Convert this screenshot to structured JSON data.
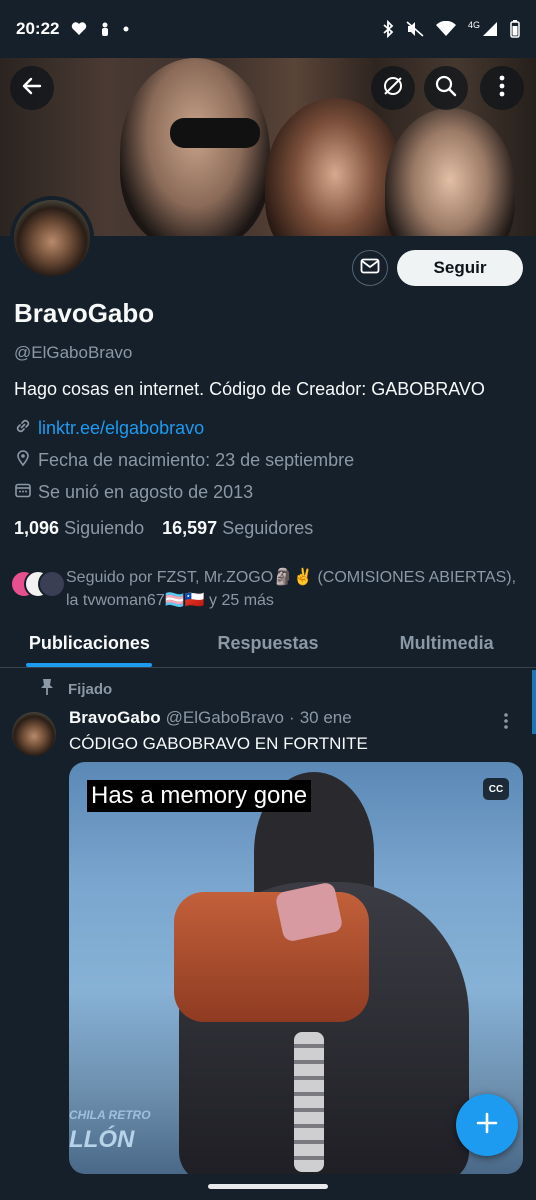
{
  "status_bar": {
    "time": "20:22",
    "network": "4G"
  },
  "profile": {
    "display_name": "BravoGabo",
    "handle": "@ElGaboBravo",
    "bio": "Hago cosas en internet. Código de Creador: GABOBRAVO",
    "link": "linktr.ee/elgabobravo",
    "birth": "Fecha de nacimiento: 23 de septiembre",
    "joined": "Se unió en agosto de 2013",
    "following_count": "1,096",
    "following_label": "Siguiendo",
    "followers_count": "16,597",
    "followers_label": "Seguidores",
    "followed_by_line1": "Seguido por FZST, Mr.ZOGO🗿✌️ (COMISIONES ABIERTAS),",
    "followed_by_line2": "la tvwoman67🏳️‍⚧️🇨🇱 y 25 más"
  },
  "actions": {
    "follow_label": "Seguir"
  },
  "tabs": [
    {
      "label": "Publicaciones",
      "active": true
    },
    {
      "label": "Respuestas",
      "active": false
    },
    {
      "label": "Multimedia",
      "active": false
    }
  ],
  "tweet": {
    "pinned_label": "Fijado",
    "author_name": "BravoGabo",
    "author_handle": "@ElGaboBravo",
    "separator": "·",
    "date": "30 ene",
    "text": "CÓDIGO GABOBRAVO EN FORTNITE",
    "media_caption": "Has a memory gone",
    "media_cc": "CC",
    "media_bottom_small": "CHILA RETRO",
    "media_bottom_big": "LLÓN"
  },
  "colors": {
    "background": "#15202b",
    "accent": "#1d9bf0",
    "secondary_text": "#8b98a5"
  },
  "icons": [
    "back-arrow-icon",
    "no-grok-icon",
    "search-icon",
    "more-vertical-icon",
    "mail-icon",
    "link-icon",
    "location-pin-icon",
    "calendar-icon",
    "pin-icon",
    "plus-icon"
  ]
}
